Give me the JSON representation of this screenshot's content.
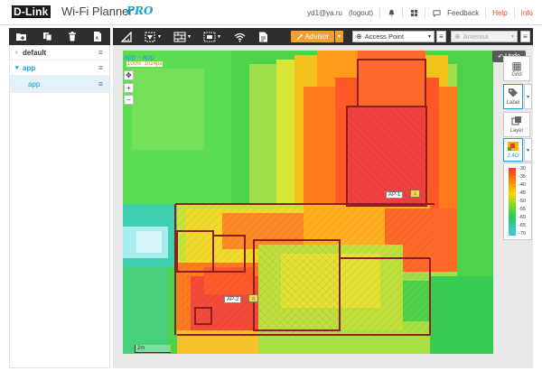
{
  "app": {
    "brand": "D-Link",
    "product": "Wi-Fi Planner",
    "product_suffix": "PRO"
  },
  "header": {
    "user": "yd1@ya.ru",
    "logout": "(logout)",
    "feedback": "Feedback",
    "help": "Help",
    "info": "Info",
    "icons": [
      "bell-icon",
      "grid-icon",
      "chat-icon"
    ]
  },
  "left_toolbar": {
    "icons": [
      "folder-add-icon",
      "copy-icon",
      "trash-icon",
      "document-icon"
    ]
  },
  "tree": {
    "items": [
      {
        "label": "default",
        "type": "group",
        "expanded": false
      },
      {
        "label": "app",
        "type": "group",
        "expanded": true
      },
      {
        "label": "app",
        "type": "floor",
        "selected": true
      }
    ]
  },
  "toolbar": {
    "icons": [
      "ruler-icon",
      "signal-select-icon",
      "wall-grid-icon",
      "area-grid-icon",
      "wifi-icon",
      "report-icon"
    ],
    "advisor_label": "Advisor",
    "access_point_select": "Access Point",
    "antenna_select": "Antenna"
  },
  "canvas": {
    "breadcrumb": "app - app",
    "sub_label": "100%: 1024px",
    "scale_label": "2m",
    "access_points": [
      {
        "label": "AP-1"
      },
      {
        "label": "AP-2"
      }
    ]
  },
  "right_panel": {
    "undo": "Undo",
    "grid": "Grid",
    "label": "Label",
    "layer": "Layer",
    "band": "2.4G",
    "legend_ticks": [
      "-30",
      "-35",
      "-40",
      "-45",
      "-50",
      "-55",
      "-60",
      "-65",
      "-70"
    ]
  },
  "colors": {
    "accent": "#1ba1d9",
    "advisor": "#f0a030",
    "toolbar_bg": "#2e2e2e",
    "link_red": "#d9531e"
  }
}
